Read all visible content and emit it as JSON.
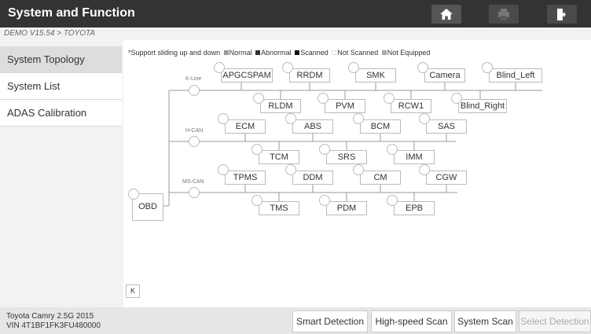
{
  "header": {
    "title": "System and Function",
    "home_icon": "home-icon",
    "print_icon": "printer-icon",
    "exit_icon": "exit-icon"
  },
  "breadcrumb": "DEMO V15.54 > TOYOTA",
  "sidebar": {
    "items": [
      {
        "label": "System Topology",
        "active": true
      },
      {
        "label": "System List",
        "active": false
      },
      {
        "label": "ADAS Calibration",
        "active": false
      }
    ]
  },
  "legend": {
    "prefix": "*Support sliding up and down",
    "items": [
      {
        "label": "Normal",
        "color": "#999999"
      },
      {
        "label": "Abnormal",
        "color": "#333333"
      },
      {
        "label": "Scanned",
        "color": "#111111"
      },
      {
        "label": "Not Scanned",
        "color": "#ffffff"
      },
      {
        "label": "Not Equipped",
        "color": "#aaaaaa"
      }
    ]
  },
  "topology": {
    "root": "OBD",
    "buses": [
      {
        "name": "K-Line",
        "top_row": [
          "APGCSPAM",
          "RRDM",
          "SMK",
          "Camera",
          "Blind_Left"
        ],
        "bottom_row": [
          "RLDM",
          "PVM",
          "RCW1",
          "Blind_Right"
        ]
      },
      {
        "name": "H-CAN",
        "top_row": [
          "ECM",
          "ABS",
          "BCM",
          "SAS"
        ],
        "bottom_row": [
          "TCM",
          "SRS",
          "IMM"
        ]
      },
      {
        "name": "MS-CAN",
        "top_row": [
          "TPMS",
          "DDM",
          "CM",
          "CGW"
        ],
        "bottom_row": [
          "TMS",
          "PDM",
          "EPB"
        ]
      }
    ]
  },
  "collapse_label": "K",
  "footer": {
    "vehicle_line1": "Toyota Camry 2.5G 2015",
    "vehicle_line2": "VIN 4T1BF1FK3FU480000",
    "buttons": [
      {
        "label": "Smart Detection",
        "enabled": true
      },
      {
        "label": "High-speed Scan",
        "enabled": true
      },
      {
        "label": "System Scan",
        "enabled": true
      },
      {
        "label": "Select Detection",
        "enabled": false
      }
    ]
  }
}
